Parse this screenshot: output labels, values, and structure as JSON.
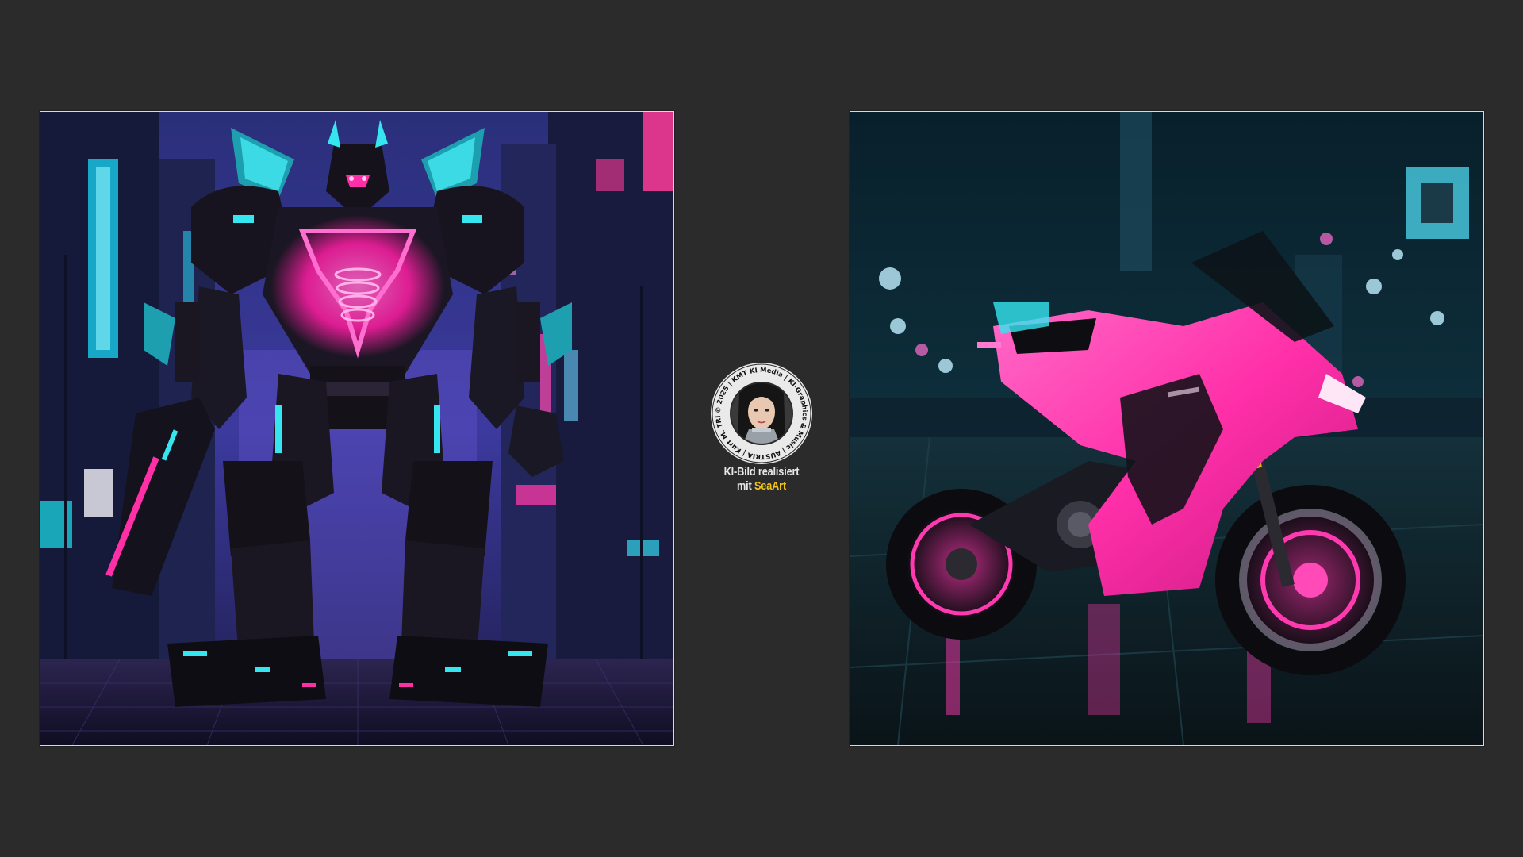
{
  "images": {
    "left": {
      "description_icon": "robot-mech-artwork"
    },
    "right": {
      "description_icon": "motorcycle-artwork"
    }
  },
  "badge": {
    "ring_text": "© 2025 | KMT KI Media | KI-Graphics & Music | AUSTRIA | Kurt M. TRISCHL | Music-Arts.com | KMTone | KI-Music.at",
    "icon": "portrait-avatar-icon"
  },
  "caption": {
    "line1": "KI-Bild realisiert",
    "line2_prefix": "mit ",
    "brand": "SeaArt"
  },
  "colors": {
    "background": "#2b2b2b",
    "accent_brand": "#f2c318",
    "neon_pink": "#ff2fa8",
    "neon_cyan": "#35e6f0"
  }
}
